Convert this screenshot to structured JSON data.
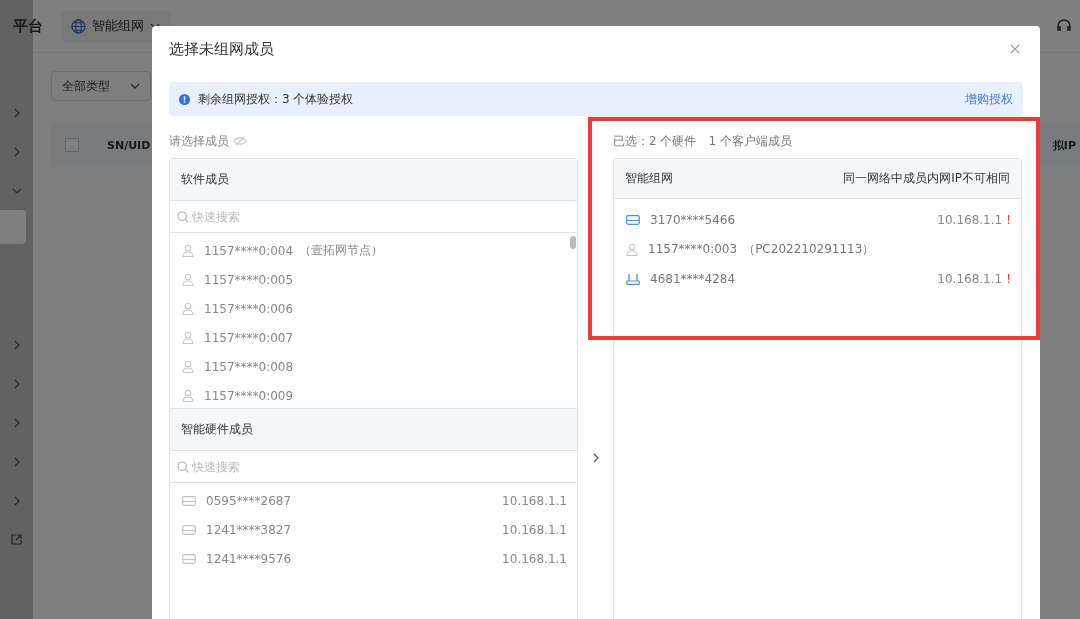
{
  "background": {
    "brand_fragment": "平台",
    "network_select": "智能组网",
    "type_select": "全部类型",
    "select_all_checked": false,
    "table_columns": [
      "SN/UID",
      "拟IP"
    ],
    "sidebar": {
      "items": [
        {
          "kind": "group",
          "expanded": false
        },
        {
          "kind": "group",
          "expanded": false
        },
        {
          "kind": "group",
          "expanded": true,
          "children": [
            {
              "selected": true
            },
            {
              "selected": false
            },
            {
              "selected": false
            }
          ]
        },
        {
          "kind": "group",
          "expanded": false
        },
        {
          "kind": "group",
          "expanded": false
        },
        {
          "kind": "group",
          "expanded": false
        },
        {
          "kind": "group",
          "expanded": false
        },
        {
          "kind": "group",
          "expanded": false
        },
        {
          "kind": "link"
        }
      ]
    }
  },
  "dialog": {
    "title": "选择未组网成员",
    "notice": {
      "text": "剩余组网授权：3 个体验授权",
      "action": "增购授权"
    },
    "left": {
      "label": "请选择成员",
      "sections": [
        {
          "title": "软件成员",
          "search_placeholder": "快速搜索",
          "scrollable": true,
          "items": [
            {
              "kind": "client",
              "name": "1157****0:004",
              "note": "（壹拓网节点）"
            },
            {
              "kind": "client",
              "name": "1157****0:005"
            },
            {
              "kind": "client",
              "name": "1157****0:006"
            },
            {
              "kind": "client",
              "name": "1157****0:007"
            },
            {
              "kind": "client",
              "name": "1157****0:008"
            },
            {
              "kind": "client",
              "name": "1157****0:009"
            }
          ]
        },
        {
          "title": "智能硬件成员",
          "search_placeholder": "快速搜索",
          "items": [
            {
              "kind": "device",
              "name": "0595****2687",
              "ip": "10.168.1.1"
            },
            {
              "kind": "device",
              "name": "1241****3827",
              "ip": "10.168.1.1"
            },
            {
              "kind": "device",
              "name": "1241****9576",
              "ip": "10.168.1.1"
            }
          ]
        }
      ]
    },
    "right": {
      "summary": [
        "已选：2 个硬件",
        "1 个客户端成员"
      ],
      "title": "智能组网",
      "hint": "同一网络中成员内网IP不可相同",
      "items": [
        {
          "kind": "device",
          "name": "3170****5466",
          "ip": "10.168.1.1",
          "warning": "!"
        },
        {
          "kind": "client",
          "name": "1157****0:003",
          "note": "（PC202210291113）"
        },
        {
          "kind": "router",
          "name": "4681****4284",
          "ip": "10.168.1.1",
          "warning": "!"
        }
      ]
    },
    "highlighted": true
  }
}
